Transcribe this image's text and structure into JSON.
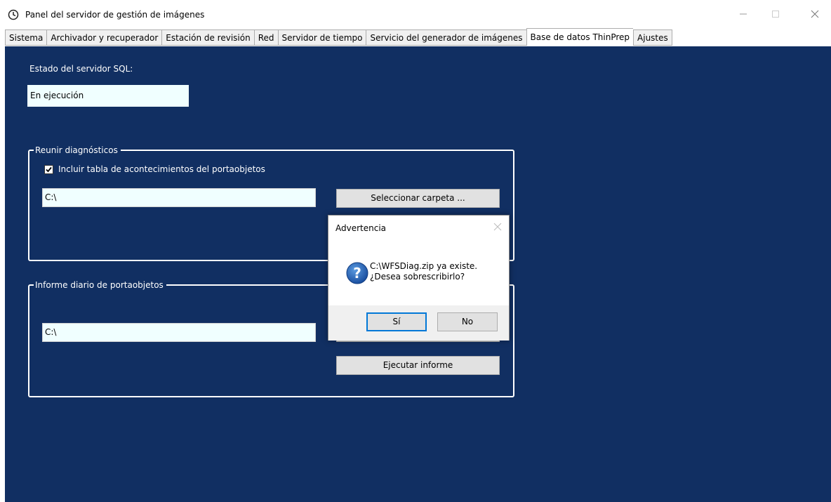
{
  "window": {
    "title": "Panel del servidor de gestión de imágenes",
    "app_icon": "clock-icon",
    "controls": [
      "minimize-icon",
      "maximize-icon",
      "close-icon"
    ]
  },
  "tabs": [
    {
      "label": "Sistema"
    },
    {
      "label": "Archivador y recuperador"
    },
    {
      "label": "Estación de revisión"
    },
    {
      "label": "Red"
    },
    {
      "label": "Servidor de tiempo"
    },
    {
      "label": "Servicio del generador de imágenes"
    },
    {
      "label": "Base de datos ThinPrep",
      "active": true
    },
    {
      "label": "Ajustes"
    }
  ],
  "panel": {
    "background": "#112f62",
    "sql_status_label": "Estado del servidor SQL:",
    "sql_status_value": "En ejecución",
    "diagnostics": {
      "title": "Reunir diagnósticos",
      "checkbox_label": "Incluir tabla de acontecimientos del portaobjetos",
      "checkbox_checked": true,
      "path": "C:\\",
      "select_folder_button": "Seleccionar carpeta ..."
    },
    "daily_report": {
      "title": "Informe diario de portaobjetos",
      "path": "C:\\",
      "run_report_button": "Ejecutar informe"
    }
  },
  "dialog": {
    "title": "Advertencia",
    "icon": "question-icon",
    "message_line1": "C:\\WFSDiag.zip ya existe.",
    "message_line2": "¿Desea sobrescribirlo?",
    "yes_button": "Sí",
    "no_button": "No"
  }
}
